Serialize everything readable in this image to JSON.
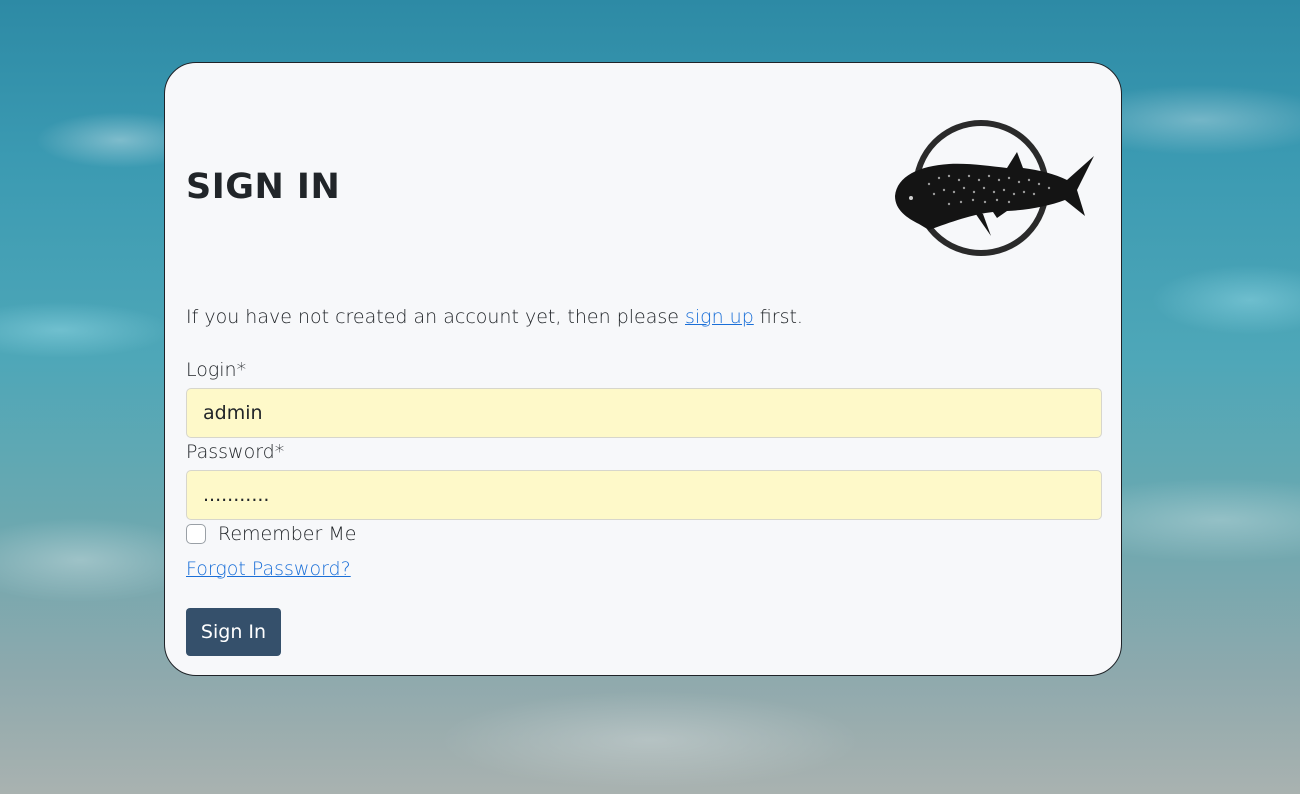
{
  "page": {
    "title": "SIGN IN"
  },
  "intro": {
    "before": "If you have not created an account yet, then please ",
    "link": "sign up",
    "after": " first."
  },
  "form": {
    "login_label": "Login*",
    "login_value": "admin",
    "password_label": "Password*",
    "password_value": "...........",
    "remember_label": "Remember Me",
    "remember_checked": false,
    "forgot_label": "Forgot Password?",
    "submit_label": "Sign In"
  },
  "icons": {
    "logo": "whale-shark-logo"
  },
  "colors": {
    "card_bg": "#f7f8fa",
    "input_bg": "#fef9c9",
    "link": "#1a6fd8",
    "button_bg": "#35506b",
    "text": "#212529"
  }
}
